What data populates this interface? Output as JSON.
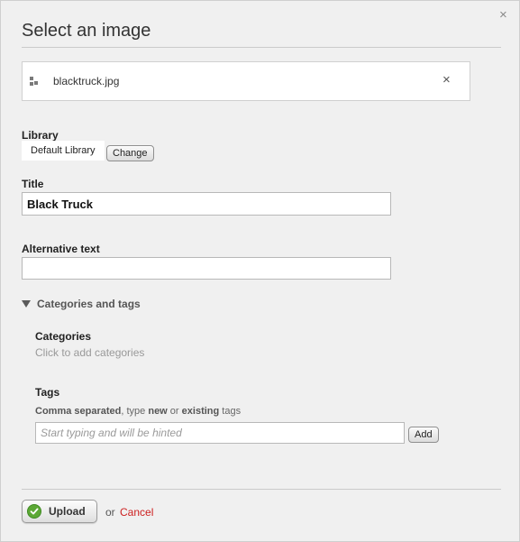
{
  "dialog": {
    "title": "Select an image",
    "close_glyph": "×"
  },
  "file": {
    "name": "blacktruck.jpg",
    "remove_glyph": "×",
    "handle_icon": "drag-handle-icon"
  },
  "library": {
    "label": "Library",
    "name": "Default Library",
    "change_label": "Change"
  },
  "title_field": {
    "label": "Title",
    "value": "Black Truck"
  },
  "alt_field": {
    "label": "Alternative text",
    "value": ""
  },
  "categories_tags": {
    "toggle_label": "Categories and tags",
    "categories_label": "Categories",
    "categories_placeholder": "Click to add categories",
    "tags_label": "Tags",
    "hint_bold1": "Comma separated",
    "hint_text1": ", type ",
    "hint_bold2": "new",
    "hint_text2": " or ",
    "hint_bold3": "existing",
    "hint_text3": " tags",
    "tags_placeholder": "Start typing and will be hinted",
    "add_label": "Add"
  },
  "footer": {
    "upload_label": "Upload",
    "or_text": "or",
    "cancel_label": "Cancel"
  },
  "colors": {
    "background": "#f0f0f0",
    "cancel": "#cc1f1f",
    "upload_check": "#5ca835"
  }
}
